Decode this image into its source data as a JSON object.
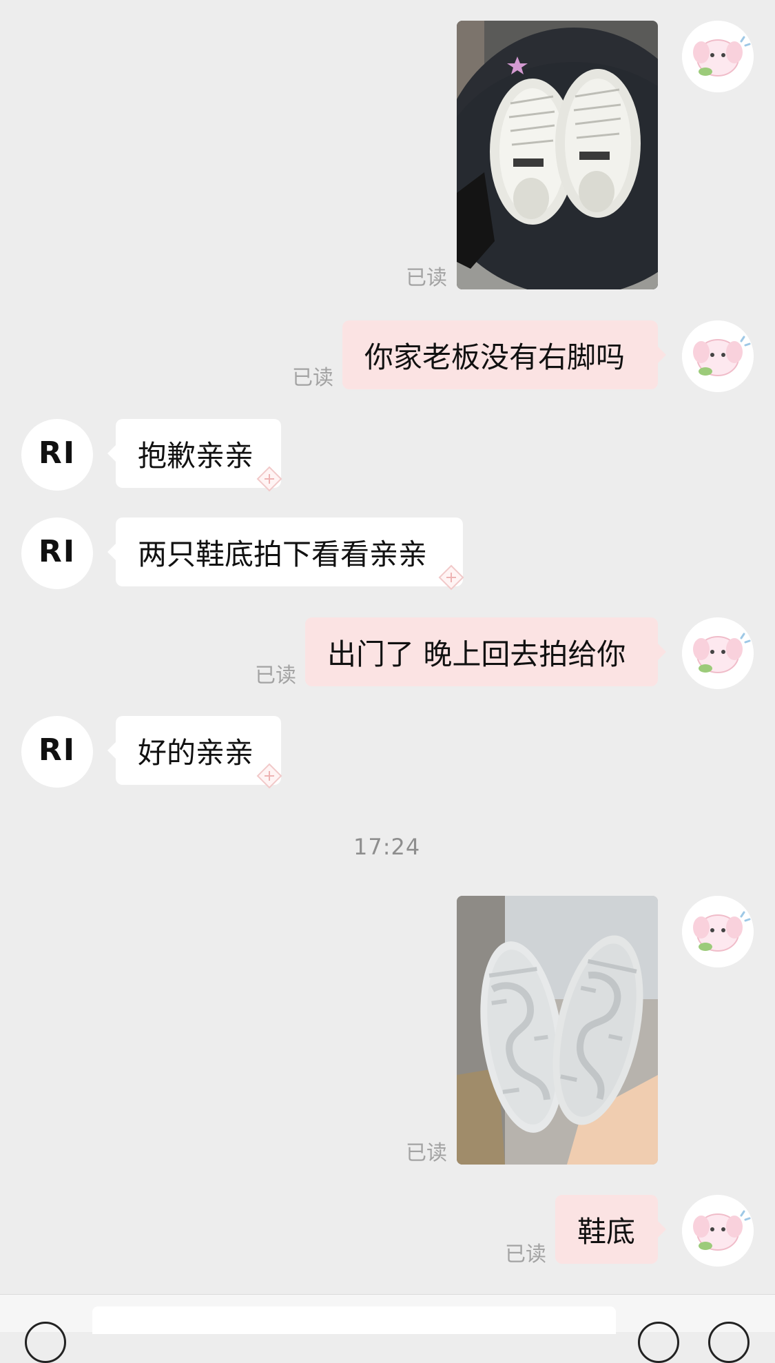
{
  "messages": {
    "img1_read": "已读",
    "m1_text": "你家老板没有右脚吗",
    "m1_read": "已读",
    "m2_text": "抱歉亲亲",
    "m3_text": "两只鞋底拍下看看亲亲",
    "m4_text": "出门了 晚上回去拍给你",
    "m4_read": "已读",
    "m5_text": "好的亲亲",
    "img2_read": "已读",
    "m6_text": "鞋底",
    "m6_read": "已读"
  },
  "time_divider": "17:24",
  "contact": {
    "avatar_text": "RI"
  },
  "colors": {
    "background": "#ededed",
    "my_bubble": "#fbe3e3",
    "their_bubble": "#ffffff",
    "read_label": "#a3a3a3"
  }
}
